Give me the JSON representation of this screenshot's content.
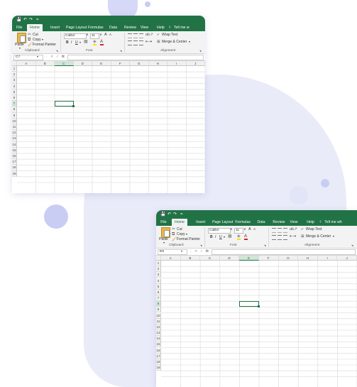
{
  "colors": {
    "excel_green": "#217346",
    "ribbon_bg": "#f3f3f3",
    "deco_light": "#e9ebf8",
    "deco_mid": "#c9cdf3"
  },
  "windows": [
    {
      "quick_access": [
        "💾",
        "↶",
        "↷",
        "="
      ],
      "tabs": [
        "File",
        "Home",
        "Insert",
        "Page Layout",
        "Formulas",
        "Data",
        "Review",
        "View",
        "Help",
        "Tell me w"
      ],
      "tell_me_icon": "lightbulb-icon",
      "clipboard": {
        "paste": "Paste",
        "cut": "Cut",
        "copy": "Copy",
        "format_painter": "Format Painter",
        "group": "Clipboard"
      },
      "font": {
        "name": "Calibri",
        "size": "11",
        "grow": "A",
        "shrink": "A",
        "bold": "B",
        "italic": "I",
        "underline": "U",
        "group": "Font"
      },
      "alignment": {
        "wrap_text": "Wrap Text",
        "merge_center": "Merge & Center",
        "group": "Alignment"
      },
      "name_box": "C7",
      "fx": "fx",
      "columns": [
        "A",
        "B",
        "C",
        "D",
        "E",
        "F",
        "G",
        "H",
        "I",
        "J"
      ],
      "selected_column": "C",
      "rows": [
        "1",
        "2",
        "3",
        "4",
        "5",
        "6",
        "7",
        "8",
        "9",
        "10",
        "11",
        "12",
        "13",
        "14",
        "15",
        "16",
        "17",
        "18",
        "19"
      ],
      "selected_row": "7"
    },
    {
      "quick_access": [
        "💾",
        "↶",
        "↷",
        "="
      ],
      "tabs": [
        "File",
        "Home",
        "Insert",
        "Page Layout",
        "Formulas",
        "Data",
        "Review",
        "View",
        "Help",
        "Tell me wh"
      ],
      "tell_me_icon": "lightbulb-icon",
      "clipboard": {
        "paste": "Paste",
        "cut": "Cut",
        "copy": "Copy",
        "format_painter": "Format Painter",
        "group": "Clipboard"
      },
      "font": {
        "name": "Calibri",
        "size": "11",
        "grow": "A",
        "shrink": "A",
        "bold": "B",
        "italic": "I",
        "underline": "U",
        "group": "Font"
      },
      "alignment": {
        "wrap_text": "Wrap Text",
        "merge_center": "Merge & Center",
        "group": "Alignment"
      },
      "name_box": "E8",
      "fx": "fx",
      "columns": [
        "A",
        "B",
        "C",
        "D",
        "E",
        "F",
        "G",
        "H",
        "I",
        "J"
      ],
      "selected_column": "E",
      "rows": [
        "1",
        "2",
        "3",
        "4",
        "5",
        "6",
        "7",
        "8",
        "9",
        "10",
        "11",
        "12",
        "13",
        "14",
        "15",
        "16",
        "17",
        "18",
        "19"
      ],
      "selected_row": "8"
    }
  ]
}
